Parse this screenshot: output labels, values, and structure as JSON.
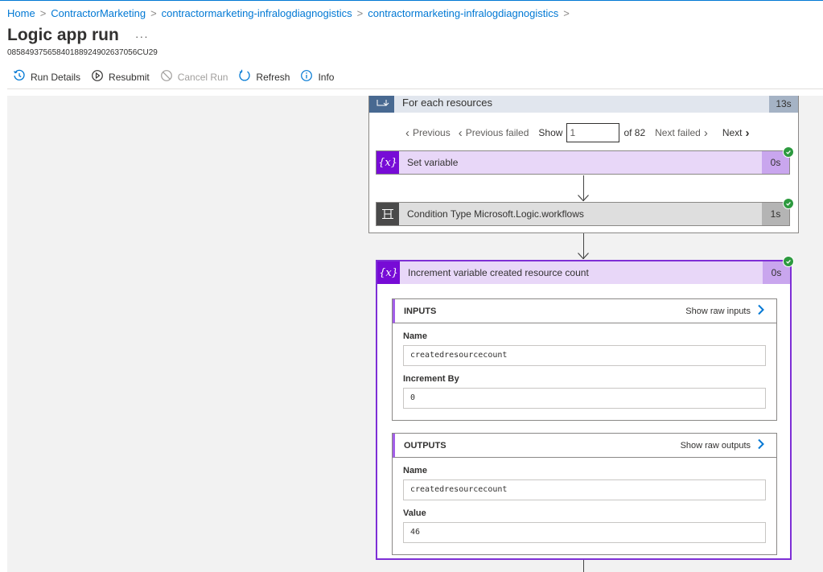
{
  "breadcrumb": [
    {
      "label": "Home"
    },
    {
      "label": "ContractorMarketing"
    },
    {
      "label": "contractormarketing-infralogdiagnogistics"
    },
    {
      "label": "contractormarketing-infralogdiagnogistics"
    }
  ],
  "breadcrumb_separator": ">",
  "header": {
    "title": "Logic app run",
    "more_label": "···",
    "run_id": "08584937565840188924902637056CU29"
  },
  "toolbar": {
    "run_details": "Run Details",
    "resubmit": "Resubmit",
    "cancel_run": "Cancel Run",
    "refresh": "Refresh",
    "info": "Info"
  },
  "foreach": {
    "title": "For each resources",
    "duration": "13s",
    "pager": {
      "previous": "Previous",
      "previous_failed": "Previous failed",
      "show": "Show",
      "current": "1",
      "of_total": "of 82",
      "next_failed": "Next failed",
      "next": "Next"
    },
    "actions": [
      {
        "icon": "variable-icon",
        "label": "Set variable",
        "duration": "0s",
        "status": "succeeded"
      },
      {
        "icon": "condition-icon",
        "label": "Condition Type Microsoft.Logic.workflows",
        "duration": "1s",
        "status": "succeeded"
      }
    ]
  },
  "increment": {
    "icon": "variable-icon",
    "label": "Increment variable created resource count",
    "duration": "0s",
    "status": "succeeded",
    "inputs": {
      "title": "INPUTS",
      "raw_link": "Show raw inputs",
      "fields": [
        {
          "label": "Name",
          "value": "createdresourcecount"
        },
        {
          "label": "Increment By",
          "value": "0"
        }
      ]
    },
    "outputs": {
      "title": "OUTPUTS",
      "raw_link": "Show raw outputs",
      "fields": [
        {
          "label": "Name",
          "value": "createdresourcecount"
        },
        {
          "label": "Value",
          "value": "46"
        }
      ]
    }
  },
  "colors": {
    "accent": "#0078d4",
    "variable_action": "#770bd6",
    "success": "#2d9a3f",
    "selected_border": "#7e2fd6"
  }
}
